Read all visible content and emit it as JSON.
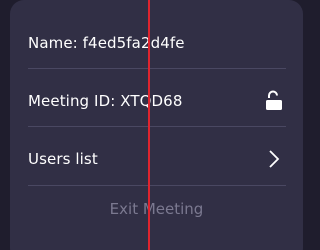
{
  "menu": {
    "name_row": "Name: f4ed5fa2d4fe",
    "meeting_row": "Meeting ID: XTQD68",
    "meeting_lock_icon": "unlock-icon",
    "users_row": "Users list",
    "users_chevron_icon": "chevron-right-icon",
    "exit_label": "Exit Meeting"
  },
  "colors": {
    "background": "#1f1d2d",
    "panel": "#312f45",
    "text": "#ffffff",
    "muted_text": "#7b7990",
    "divider": "#4a4862",
    "overlay_line": "#e0242e"
  }
}
